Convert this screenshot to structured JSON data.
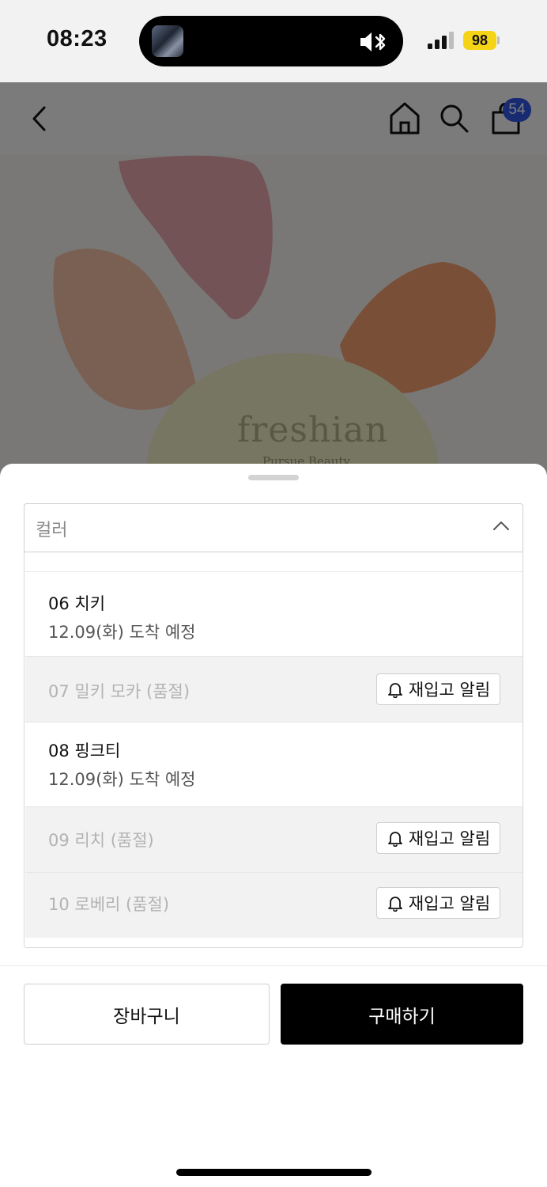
{
  "status_bar": {
    "time": "08:23",
    "battery": "98"
  },
  "nav": {
    "cart_count": "54"
  },
  "product_image": {
    "brand": "freshian",
    "tagline": "Pursue Beauty"
  },
  "color_select": {
    "label": "컬러"
  },
  "options": [
    {
      "name": "06 치키",
      "delivery": "12.09(화) 도착 예정",
      "sold_out": false
    },
    {
      "name": "07 밀키 모카 (품절)",
      "notify_label": "재입고 알림",
      "sold_out": true
    },
    {
      "name": "08 핑크티",
      "delivery": "12.09(화) 도착 예정",
      "sold_out": false
    },
    {
      "name": "09 리치 (품절)",
      "notify_label": "재입고 알림",
      "sold_out": true
    },
    {
      "name": "10 로베리 (품절)",
      "notify_label": "재입고 알림",
      "sold_out": true
    }
  ],
  "actions": {
    "cart_label": "장바구니",
    "buy_label": "구매하기"
  },
  "icons": {
    "back": "back-chevron-icon",
    "home": "home-icon",
    "search": "search-icon",
    "cart": "shopping-bag-icon",
    "bell": "bell-icon"
  },
  "colors": {
    "badge": "#2f55e4",
    "battery": "#f5d315",
    "buy_button": "#000000"
  }
}
